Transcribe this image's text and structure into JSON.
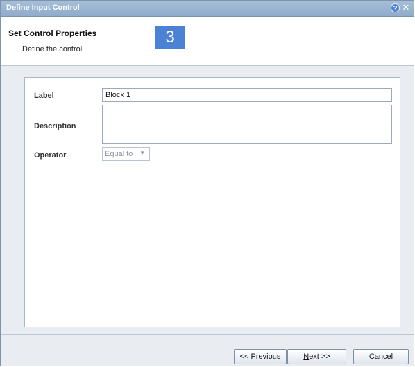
{
  "window": {
    "title": "Define Input Control",
    "help_icon": "?",
    "close_icon": "✕"
  },
  "step": {
    "title": "Set Control Properties",
    "subtitle": "Define the control",
    "number": "3"
  },
  "form": {
    "label_caption": "Label",
    "label_value": "Block 1",
    "description_caption": "Description",
    "description_value": "",
    "operator_caption": "Operator",
    "operator_value": "Equal to",
    "operator_arrow": "▼"
  },
  "buttons": {
    "previous": "<< Previous",
    "next_mnemonic": "N",
    "next_rest": "ext >>",
    "cancel": "Cancel"
  },
  "colors": {
    "titlebar": "#8faccb",
    "step_badge": "#4c82d6",
    "content_bg": "#e9edf2"
  }
}
